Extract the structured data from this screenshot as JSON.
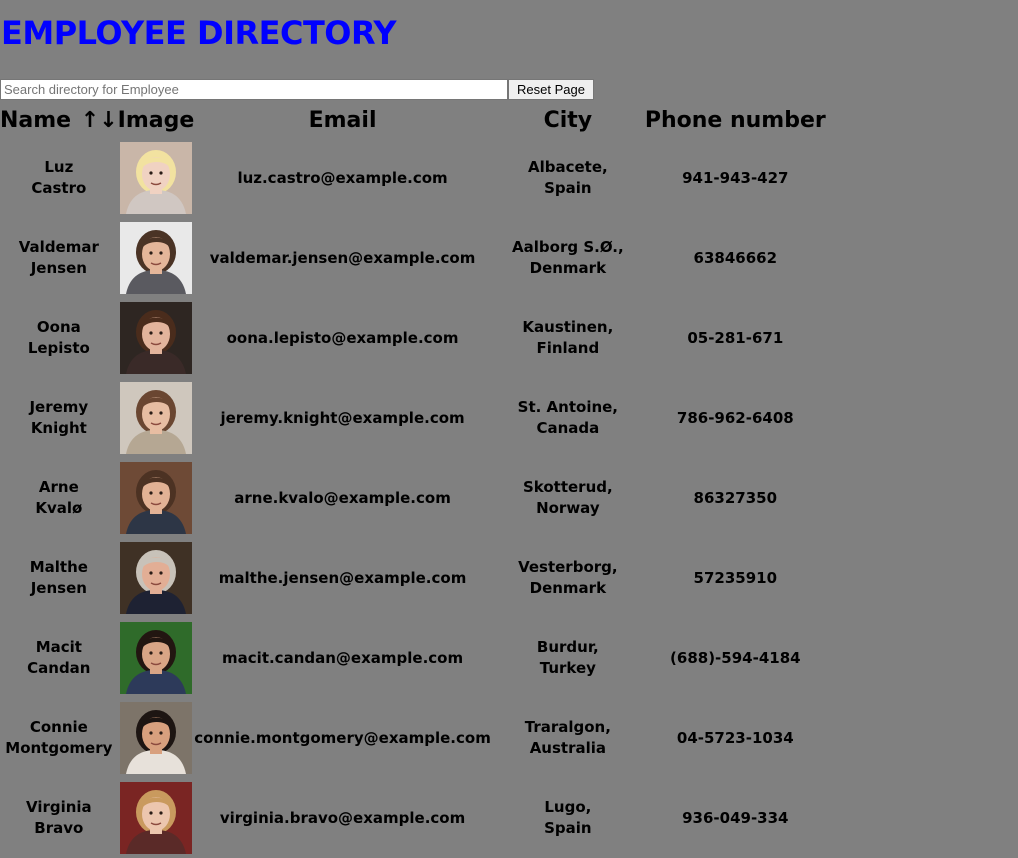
{
  "page": {
    "title": "EMPLOYEE DIRECTORY"
  },
  "search": {
    "placeholder": "Search directory for Employee",
    "value": ""
  },
  "reset_button": {
    "label": "Reset Page"
  },
  "table": {
    "headers": {
      "name": "Name",
      "name_sort_icon": "↑↓",
      "image": "Image",
      "email": "Email",
      "city": "City",
      "phone": "Phone number"
    },
    "rows": [
      {
        "first": "Luz",
        "last": "Castro",
        "email": "luz.castro@example.com",
        "city": "Albacete,",
        "country": "Spain",
        "phone": "941-943-427",
        "avatar": {
          "bg": "#c9b6a8",
          "skin": "#f0d2c2",
          "hair": "#f2e2a0",
          "shirt": "#d0c7c2"
        }
      },
      {
        "first": "Valdemar",
        "last": "Jensen",
        "email": "valdemar.jensen@example.com",
        "city": "Aalborg S.Ø.,",
        "country": "Denmark",
        "phone": "63846662",
        "avatar": {
          "bg": "#e9e9e9",
          "skin": "#e4b69a",
          "hair": "#4a3325",
          "shirt": "#5a5a60"
        }
      },
      {
        "first": "Oona",
        "last": "Lepisto",
        "email": "oona.lepisto@example.com",
        "city": "Kaustinen,",
        "country": "Finland",
        "phone": "05-281-671",
        "avatar": {
          "bg": "#2e2622",
          "skin": "#e3b49c",
          "hair": "#4a2c1c",
          "shirt": "#3a2a28"
        }
      },
      {
        "first": "Jeremy",
        "last": "Knight",
        "email": "jeremy.knight@example.com",
        "city": "St. Antoine,",
        "country": "Canada",
        "phone": "786-962-6408",
        "avatar": {
          "bg": "#cfc7bd",
          "skin": "#e7bda2",
          "hair": "#6a4631",
          "shirt": "#b5a793"
        }
      },
      {
        "first": "Arne",
        "last": "Kvalø",
        "email": "arne.kvalo@example.com",
        "city": "Skotterud,",
        "country": "Norway",
        "phone": "86327350",
        "avatar": {
          "bg": "#6e4a36",
          "skin": "#e2b295",
          "hair": "#4c3223",
          "shirt": "#2d3646"
        }
      },
      {
        "first": "Malthe",
        "last": "Jensen",
        "email": "malthe.jensen@example.com",
        "city": "Vesterborg,",
        "country": "Denmark",
        "phone": "57235910",
        "avatar": {
          "bg": "#3f3125",
          "skin": "#e2ae95",
          "hair": "#c8c2b9",
          "shirt": "#1e2233"
        }
      },
      {
        "first": "Macit",
        "last": "Candan",
        "email": "macit.candan@example.com",
        "city": "Burdur,",
        "country": "Turkey",
        "phone": "(688)-594-4184",
        "avatar": {
          "bg": "#2f6b2a",
          "skin": "#d9a586",
          "hair": "#221611",
          "shirt": "#2d3a5a"
        }
      },
      {
        "first": "Connie",
        "last": "Montgomery",
        "email": "connie.montgomery@example.com",
        "city": "Traralgon,",
        "country": "Australia",
        "phone": "04-5723-1034",
        "avatar": {
          "bg": "#7d7469",
          "skin": "#d8a07e",
          "hair": "#1d1512",
          "shirt": "#e7e1da"
        }
      },
      {
        "first": "Virginia",
        "last": "Bravo",
        "email": "virginia.bravo@example.com",
        "city": "Lugo,",
        "country": "Spain",
        "phone": "936-049-334",
        "avatar": {
          "bg": "#7a2523",
          "skin": "#ecc6ae",
          "hair": "#c99a5e",
          "shirt": "#5a2a28"
        }
      }
    ]
  }
}
